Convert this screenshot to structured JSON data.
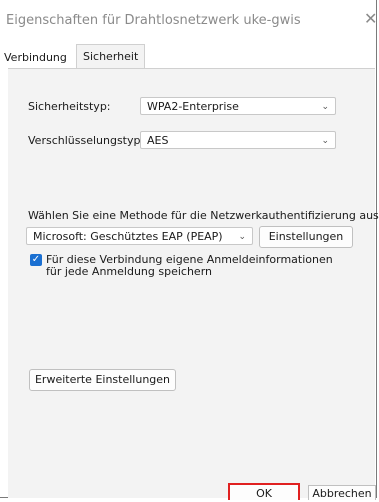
{
  "window": {
    "title": "Eigenschaften für Drahtlosnetzwerk uke-gwis",
    "close_glyph": "✕"
  },
  "tabs": [
    {
      "label": "Verbindung"
    },
    {
      "label": "Sicherheit"
    }
  ],
  "security": {
    "type_label": "Sicherheitstyp:",
    "type_value": "WPA2-Enterprise",
    "encryption_label": "Verschlüsselungstyp:",
    "encryption_value": "AES"
  },
  "auth": {
    "method_label": "Wählen Sie eine Methode für die Netzwerkauthentifizierung aus:",
    "method_value": "Microsoft: Geschütztes EAP (PEAP)",
    "settings_button": "Einstellungen",
    "remember_checkbox_label": "Für diese Verbindung eigene Anmeldeinformationen für jede Anmeldung speichern",
    "remember_checked": true
  },
  "advanced_button": "Erweiterte Einstellungen",
  "footer": {
    "ok_label": "OK",
    "cancel_label": "Abbrechen"
  },
  "icons": {
    "chevron": "chevron-down-icon",
    "checkmark": "checkmark-icon",
    "close": "close-icon"
  },
  "colors": {
    "accent": "#1a6fd1",
    "highlight": "#e02020"
  }
}
